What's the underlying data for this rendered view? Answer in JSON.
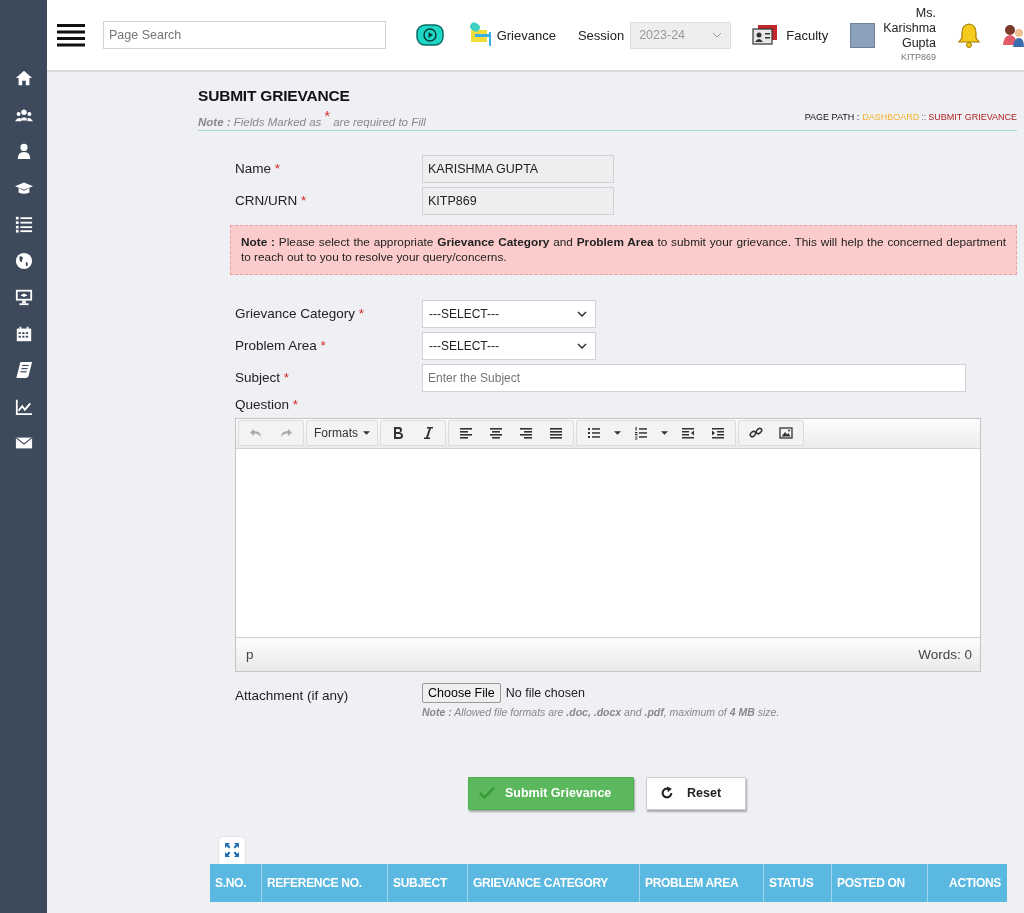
{
  "header": {
    "search": {
      "placeholder": "Page Search"
    },
    "grievance_label": "Grievance",
    "session": {
      "label": "Session",
      "value": "2023-24",
      "disabled": true
    },
    "faculty_label": "Faculty",
    "user": {
      "lines": [
        "Ms.",
        "Karishma",
        "Gupta"
      ],
      "id": "KITP869"
    }
  },
  "page": {
    "title": "SUBMIT GRIEVANCE",
    "note": "**Note :** Fields Marked as $^{*}$ are required to Fill",
    "path": {
      "label": "PAGE PATH :",
      "dashboard": "DASHBOARD",
      "separator": "::",
      "current": "SUBMIT GRIEVANCE"
    }
  },
  "identity": [
    {
      "label": "Name",
      "mark": "*",
      "value": "KARISHMA GUPTA"
    },
    {
      "label": "CRN/URN",
      "mark": "*",
      "value": "KITP869"
    }
  ],
  "notice": "**Note :** Please select the appropriate **Grievance Category** and **Problem Area** to submit your grievance. This will help the concerned department to reach out to you to resolve your query/concerns.",
  "fields": [
    {
      "kind": "select",
      "label": "Grievance Category",
      "mark": "*",
      "value": "---SELECT---"
    },
    {
      "kind": "select",
      "label": "Problem Area",
      "mark": "*",
      "value": "---SELECT---"
    },
    {
      "kind": "text",
      "label": "Subject",
      "mark": "*",
      "placeholder": "Enter the Subject"
    },
    {
      "kind": "heading",
      "label": "Question",
      "mark": "*"
    }
  ],
  "editor": {
    "formats_label": "Formats",
    "path": "p",
    "words": "Words: 0"
  },
  "attachment": {
    "label": "Attachment (if any)",
    "button": "Choose File",
    "status": "No file chosen",
    "note": "**Note :** Allowed file formats are **.doc, .docx** and **.pdf**, maximum of **4 MB** size."
  },
  "buttons": [
    {
      "kind": "submit",
      "label": "Submit Grievance"
    },
    {
      "kind": "reset",
      "label": "Reset"
    }
  ],
  "table": {
    "columns": [
      "S.NO.",
      "REFERENCE NO.",
      "SUBJECT",
      "GRIEVANCE CATEGORY",
      "PROBLEM AREA",
      "STATUS",
      "POSTED ON",
      "ACTIONS"
    ]
  }
}
